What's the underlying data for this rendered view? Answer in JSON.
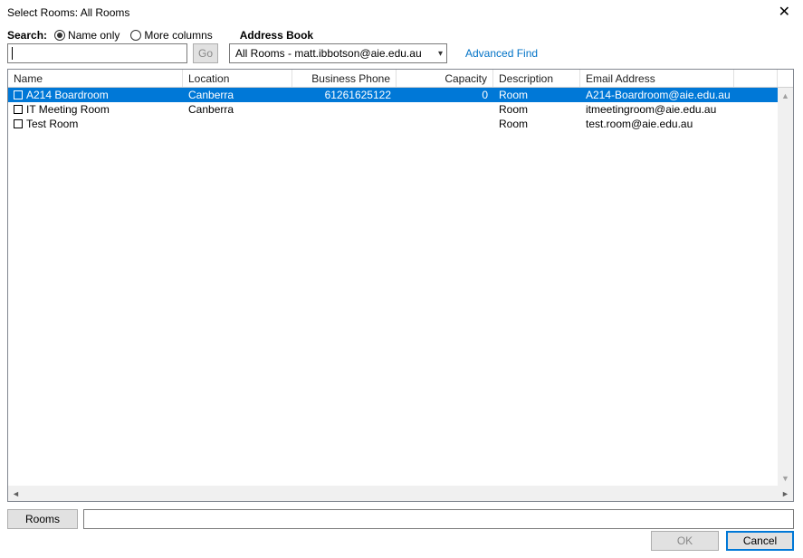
{
  "titlebar": {
    "title": "Select Rooms: All Rooms"
  },
  "search": {
    "label": "Search:",
    "radio_name_only": "Name only",
    "radio_more_columns": "More columns",
    "address_book_label": "Address Book",
    "go_label": "Go",
    "address_book_value": "All Rooms - matt.ibbotson@aie.edu.au",
    "advanced_find": "Advanced Find"
  },
  "columns": {
    "name": "Name",
    "location": "Location",
    "phone": "Business Phone",
    "capacity": "Capacity",
    "description": "Description",
    "email": "Email Address"
  },
  "rows": [
    {
      "name": "A214 Boardroom",
      "location": "Canberra",
      "phone": "61261625122",
      "capacity": "0",
      "description": "Room",
      "email": "A214-Boardroom@aie.edu.au",
      "selected": true
    },
    {
      "name": "IT Meeting Room",
      "location": "Canberra",
      "phone": "",
      "capacity": "",
      "description": "Room",
      "email": "itmeetingroom@aie.edu.au",
      "selected": false
    },
    {
      "name": "Test Room",
      "location": "",
      "phone": "",
      "capacity": "",
      "description": "Room",
      "email": "test.room@aie.edu.au",
      "selected": false
    }
  ],
  "rooms": {
    "button_label": "Rooms",
    "value": ""
  },
  "footer": {
    "ok": "OK",
    "cancel": "Cancel"
  }
}
